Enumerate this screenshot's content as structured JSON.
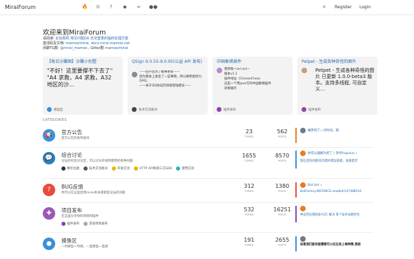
{
  "header": {
    "site_title": "MiraiForum",
    "nav_icons": [
      "fire-icon",
      "clock-icon",
      "question-icon",
      "tags-icon",
      "link-icon",
      "users-icon"
    ],
    "register": "Register",
    "login": "Login"
  },
  "welcome": {
    "title": "欢迎来到MiraiForum",
    "line1_prefix": "请阅读:",
    "line1_links": "论坛规则 常见问题QA 无法登录的临时处理方案",
    "line2_prefix": "激活码及文档:",
    "line2_links": "mamoe/mirai, docs.mirai.mamoe.net",
    "line3_prefix": "闲聊TG群:",
    "line3_links": "@mirai_mamoe",
    "line3_mid": ", Gitter群",
    "line3_links2": "mamoe/mirai"
  },
  "cards": [
    {
      "title": "【每日沙雕图】沙雕小别墅",
      "body": "\"不好！这里要撑不下去了\"\n\"A4 求救，A4 求救，A32 地区的沙…",
      "footer": "摸鱼区",
      "accent": "#3b8fd8"
    },
    {
      "title": "QSign 9.0.55-9.0.95(公益 API 发布)",
      "body": "——回不回为了敏事更新——\n因为我身上发生了一些事情，所以要积留停力QAQ。\n——关于QQ协议的快速登陆建议——",
      "footer": "技术交流板块",
      "accent": "#555"
    },
    {
      "title": "中国象棋插件",
      "body": "更新啦~(≥▽≤)/~\n版本v1.1\n插件地址: ChineseChess\n这是一个用java写的中国象棋插件\n效果展示",
      "footer": "插件发布",
      "accent": "#8e44ad"
    },
    {
      "title": "Petpet - 生成各种奇怪的图片",
      "body": "Petpet - 生成各种奇怪的图片 已更新 1.0.0-beta3 版本。支持多线程, 可自定义…",
      "footer": "插件发布",
      "accent": "#8e44ad"
    }
  ],
  "categories_label": "CATEGORIES",
  "categories": [
    {
      "name": "官方公告",
      "desc": "官方公告的发布板块",
      "topics": "23",
      "posts": "562",
      "topics_label": "TOPICS",
      "posts_label": "POSTS",
      "icon_color": "#3b8fd8",
      "latest_user": "",
      "latest_text": "睡梦到了一点时间，我",
      "latest_sub": "",
      "latest_color": "#e67e22"
    },
    {
      "name": "综合讨论",
      "desc": "论坛的综合讨论区，可以讨论开发和使用的各种问题",
      "topics": "1655",
      "posts": "8570",
      "topics_label": "TOPICS",
      "posts_label": "POSTS",
      "icon_color": "#2c7fb8",
      "subcats": [
        {
          "label": "精华主题",
          "color": "#333"
        },
        {
          "label": "技术交流板块",
          "color": "#555"
        },
        {
          "label": "开发交流",
          "color": "#e6b800"
        },
        {
          "label": "HTTP API和第三方SDK",
          "color": "#e6b800"
        },
        {
          "label": "使用交流",
          "color": "#2ab7a9"
        }
      ],
      "latest_text": "你可以理解为老了 ( 参考fuqiuluo )",
      "latest_sub": "现在还有问题/有何意外建议或者，直接是否",
      "latest_color": "#e74c3c"
    },
    {
      "name": "BUG反馈",
      "desc": "你可以在这里反馈mirai本身或者是论坛的问题",
      "topics": "312",
      "posts": "1380",
      "topics_label": "TOPICS",
      "posts_label": "POSTS",
      "icon_color": "#e74c3c",
      "latest_text": "Bot bot =",
      "latest_sub": "BotFactory.INSTANCE.newBot(147488516",
      "latest_color": "#e74c3c"
    },
    {
      "name": "项目发布",
      "desc": "在这里分享你的项目和插件",
      "topics": "532",
      "posts": "16251",
      "topics_label": "TOPICS",
      "posts_label": "POSTS",
      "icon_color": "#9b59b6",
      "subcats": [
        {
          "label": "插件发布",
          "color": "#8e44ad"
        },
        {
          "label": "其他项目发布",
          "color": "#aaa"
        }
      ],
      "latest_text": "",
      "latest_sub": "呼出宅在限制多行ZC 解决 等个技术长期合作",
      "latest_color": "#8e44ad"
    },
    {
      "name": "摸鱼区",
      "desc": "一时摸鱼一时爽，一直摸鱼一直爽",
      "topics": "191",
      "posts": "2655",
      "topics_label": "TOPICS",
      "posts_label": "POSTS",
      "icon_color": "#3b8fd8",
      "latest_text": "",
      "latest_sub": "如果我们能有能需要可以在在系上每种情,我相",
      "latest_color": "#3b8fd8"
    }
  ]
}
